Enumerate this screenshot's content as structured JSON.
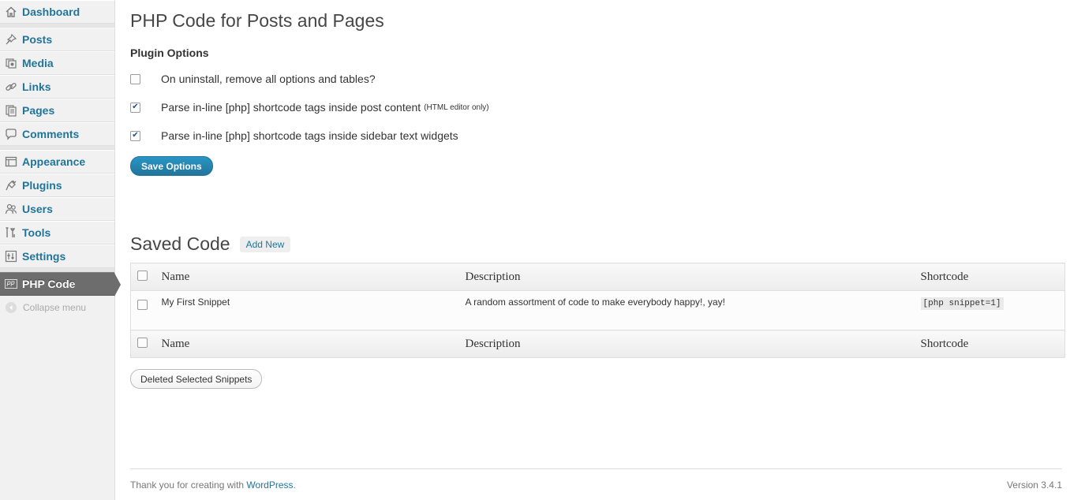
{
  "sidebar": {
    "items": [
      {
        "label": "Dashboard",
        "icon": "home-icon"
      },
      {
        "label": "Posts",
        "icon": "pushpin-icon"
      },
      {
        "label": "Media",
        "icon": "media-icon"
      },
      {
        "label": "Links",
        "icon": "chain-link-icon"
      },
      {
        "label": "Pages",
        "icon": "pages-icon"
      },
      {
        "label": "Comments",
        "icon": "comment-bubble-icon"
      },
      {
        "label": "Appearance",
        "icon": "appearance-icon"
      },
      {
        "label": "Plugins",
        "icon": "plug-icon"
      },
      {
        "label": "Users",
        "icon": "users-icon"
      },
      {
        "label": "Tools",
        "icon": "tools-icon"
      },
      {
        "label": "Settings",
        "icon": "settings-icon"
      },
      {
        "label": "PHP Code",
        "icon": "php-icon",
        "current": true
      }
    ],
    "collapse_label": "Collapse menu"
  },
  "page": {
    "title": "PHP Code for Posts and Pages",
    "plugin_options": {
      "heading": "Plugin Options",
      "options": [
        {
          "label": "On uninstall, remove all options and tables?",
          "note": "",
          "checked": false
        },
        {
          "label": "Parse in-line [php] shortcode tags inside post content",
          "note": "(HTML editor only)",
          "checked": true
        },
        {
          "label": "Parse in-line [php] shortcode tags inside sidebar text widgets",
          "note": "",
          "checked": true
        }
      ],
      "save_label": "Save Options"
    },
    "saved_code": {
      "heading": "Saved Code",
      "add_new_label": "Add New",
      "columns": [
        "Name",
        "Description",
        "Shortcode"
      ],
      "rows": [
        {
          "name": "My First Snippet",
          "description": "A random assortment of code to make everybody happy!, yay!",
          "shortcode": "[php snippet=1]"
        }
      ],
      "delete_label": "Deleted Selected Snippets"
    }
  },
  "footer": {
    "thanks_prefix": "Thank you for creating with ",
    "link_label": "WordPress",
    "thanks_suffix": ".",
    "version": "Version 3.4.1"
  },
  "colors": {
    "link": "#21759b",
    "current_menu_bg": "#6d6d6d",
    "primary_button": "#21759b"
  }
}
